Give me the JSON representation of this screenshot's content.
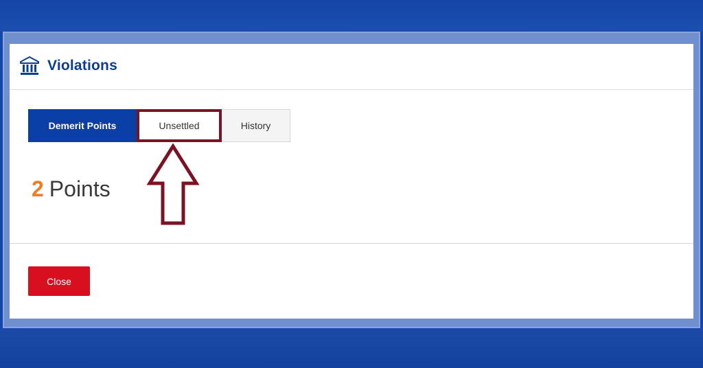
{
  "modal": {
    "title": "Violations",
    "header_icon": "bank-building-icon"
  },
  "tabs": [
    {
      "label": "Demerit Points",
      "active": true
    },
    {
      "label": "Unsettled",
      "active": false,
      "highlighted": true
    },
    {
      "label": "History",
      "active": false
    }
  ],
  "points": {
    "value": "2",
    "unit_label": "Points"
  },
  "annotation": {
    "icon": "up-arrow-annotation-icon",
    "color": "#7a1424"
  },
  "footer": {
    "close_label": "Close"
  },
  "colors": {
    "brand_blue": "#0b3fa8",
    "points_accent": "#f07d24",
    "close_red": "#d70f1e",
    "annotation": "#7a1424"
  }
}
